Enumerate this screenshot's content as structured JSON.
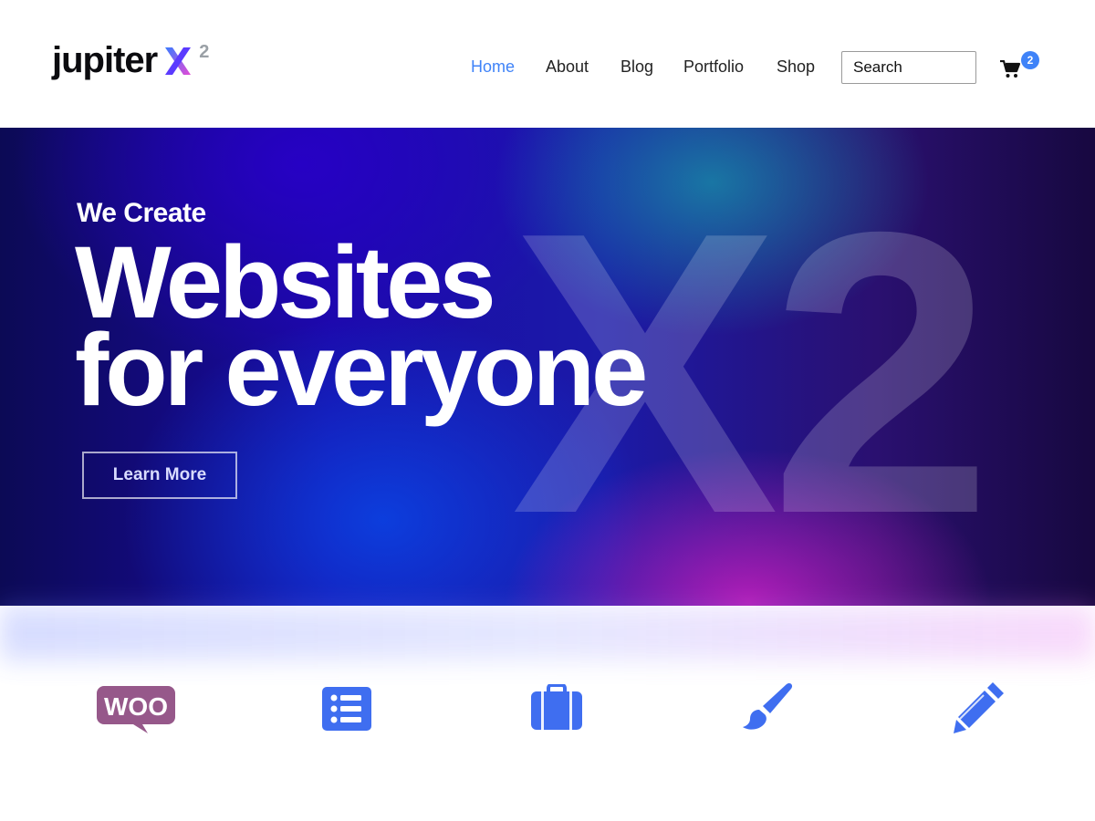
{
  "brand": {
    "logo_text": "jupiter",
    "logo_mark": "X",
    "logo_sup": "2",
    "colors": {
      "accent": "#3f83f8",
      "woo": "#96588a",
      "x_gradient_start": "#3b7bff",
      "x_gradient_end": "#e24bd6"
    }
  },
  "nav": {
    "items": [
      {
        "label": "Home",
        "active": true
      },
      {
        "label": "About",
        "active": false
      },
      {
        "label": "Blog",
        "active": false
      },
      {
        "label": "Portfolio",
        "active": false
      },
      {
        "label": "Shop",
        "active": false
      }
    ],
    "search_placeholder": "Search",
    "cart_icon": "shopping-cart-icon",
    "cart_count": "2"
  },
  "hero": {
    "kicker": "We Create",
    "headline_line1": "Websites",
    "headline_line2": "for everyone",
    "button_label": "Learn More",
    "watermark": "X2"
  },
  "features": {
    "icons": [
      {
        "name": "woocommerce-icon",
        "text": "WOO"
      },
      {
        "name": "list-icon"
      },
      {
        "name": "briefcase-icon"
      },
      {
        "name": "paint-brush-icon"
      },
      {
        "name": "pencil-icon"
      }
    ]
  }
}
